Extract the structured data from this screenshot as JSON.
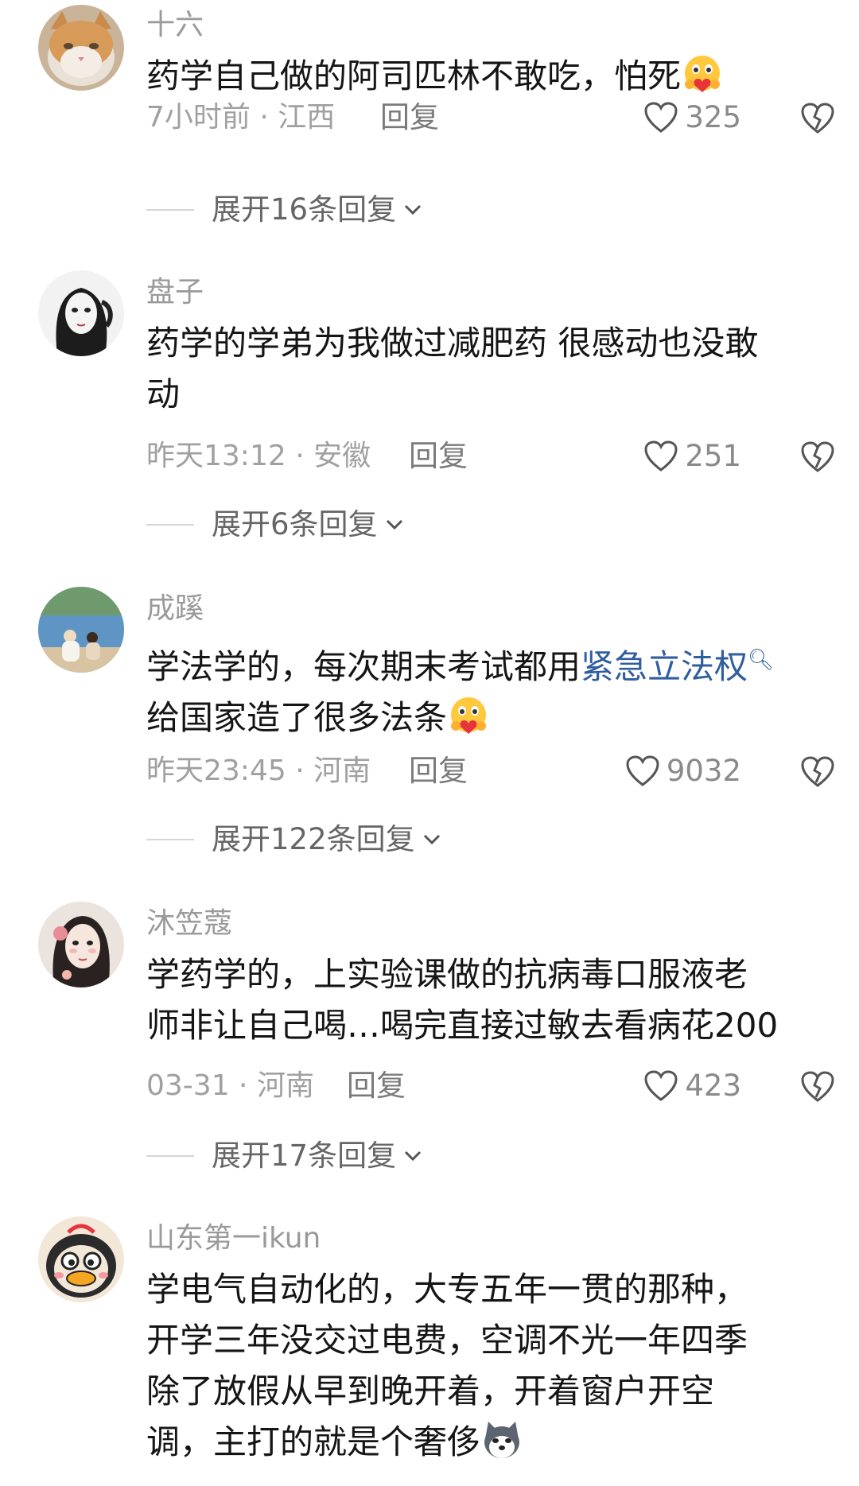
{
  "comments": [
    {
      "username": "十六",
      "text_parts": [
        "药学自己做的阿司匹林不敢吃，怕死"
      ],
      "meta": "7小时前 · 江西",
      "reply": "回复",
      "likes": "325",
      "expand": "展开16条回复",
      "avatar_icon": "cat-avatar-icon",
      "emoji": "hug-emoji-icon"
    },
    {
      "username": "盘子",
      "text_parts": [
        "药学的学弟为我做过减肥药 很感动也没敢",
        "动"
      ],
      "meta": "昨天13:12 · 安徽",
      "reply": "回复",
      "likes": "251",
      "expand": "展开6条回复",
      "avatar_icon": "girl-sketch-avatar-icon"
    },
    {
      "username": "成蹊",
      "text_parts": [
        "学法学的，每次期末考试都用",
        "紧急立法权",
        "给国家造了很多法条"
      ],
      "meta": "昨天23:45 · 河南",
      "reply": "回复",
      "likes": "9032",
      "expand": "展开122条回复",
      "avatar_icon": "lake-photo-avatar-icon",
      "emoji": "hug-emoji-icon"
    },
    {
      "username": "沐笠蔻",
      "text_parts": [
        "学药学的，上实验课做的抗病毒口服液老",
        "师非让自己喝…喝完直接过敏去看病花200"
      ],
      "meta": "03-31 · 河南",
      "reply": "回复",
      "likes": "423",
      "expand": "展开17条回复",
      "avatar_icon": "illustrated-girl-avatar-icon"
    },
    {
      "username": "山东第一ikun",
      "text_parts": [
        "学电气自动化的，大专五年一贯的那种，",
        "开学三年没交过电费，空调不光一年四季",
        "除了放假从早到晚开着，开着窗户开空",
        "调，主打的就是个奢侈"
      ],
      "avatar_icon": "duck-avatar-icon",
      "emoji": "husky-emoji-icon"
    }
  ],
  "colors": {
    "link": "#2f5d9e",
    "meta": "#a0a0a0",
    "text": "#151515"
  }
}
